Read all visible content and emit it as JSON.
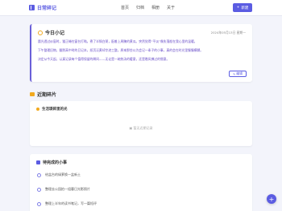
{
  "app": {
    "title": "日常碎记"
  },
  "nav": [
    "首页",
    "归档",
    "相册",
    "关于"
  ],
  "new_button": {
    "label": "新建",
    "icon": "plus-icon"
  },
  "today": {
    "title": "今日小记",
    "date": "2024年05月13日 星期一",
    "paragraphs": [
      "晨光透过纱窗时，猫正蜷在窗台打盹。煮了半锅白粥，配着上周腌的黄瓜。突然觉得“平淡”像失落般在我心里的温暖。",
      "下午整理旧物，翻到高中时的日记本，纸页泛黄却字迹工整。原来那些以为会记一辈子的小事，真的会在时光里慢慢模糊。",
      "决定从今天起，认真记录每个值得保留的瞬间——无论是一碗热汤的暖意，还是晚风拂过的惬意。"
    ],
    "edit_label": "编辑"
  },
  "fragments": {
    "section_title": "近期碎片",
    "subhead": "生活琐碎里的光",
    "empty_text": "暂无近期记录"
  },
  "todo": {
    "title": "待完成的小事",
    "items": [
      "给盆台的绿萝换一盆新土",
      "整理去公园拍一组暮日光影照片",
      "整理上半年的读书笔记，写一篇短评"
    ]
  },
  "fab": {
    "label": "+"
  },
  "colors": {
    "accent": "#5b5ce2",
    "highlight": "#f2a91e",
    "text": "#6a4fc8"
  }
}
